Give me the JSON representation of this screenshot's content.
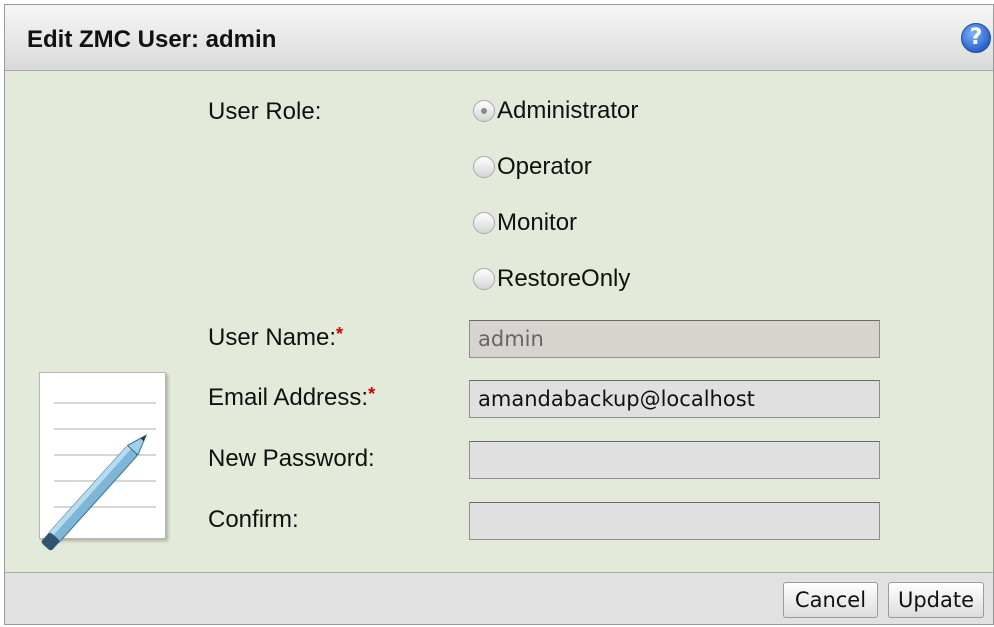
{
  "dialog": {
    "title": "Edit ZMC User: admin",
    "help_icon_glyph": "?"
  },
  "form": {
    "user_role_label": "User Role:",
    "roles": [
      {
        "label": "Administrator",
        "selected": true
      },
      {
        "label": "Operator",
        "selected": false
      },
      {
        "label": "Monitor",
        "selected": false
      },
      {
        "label": "RestoreOnly",
        "selected": false
      }
    ],
    "user_name_label": "User Name:",
    "user_name_value": "admin",
    "email_label": "Email Address:",
    "email_value": "amandabackup@localhost",
    "new_password_label": "New Password:",
    "new_password_value": "",
    "confirm_label": "Confirm:",
    "confirm_value": "",
    "required_marker": "*"
  },
  "footer": {
    "cancel_label": "Cancel",
    "update_label": "Update"
  },
  "colors": {
    "panel_background": "#e4ead9",
    "required_marker": "#d00000",
    "help_icon": "#2a62c9"
  }
}
